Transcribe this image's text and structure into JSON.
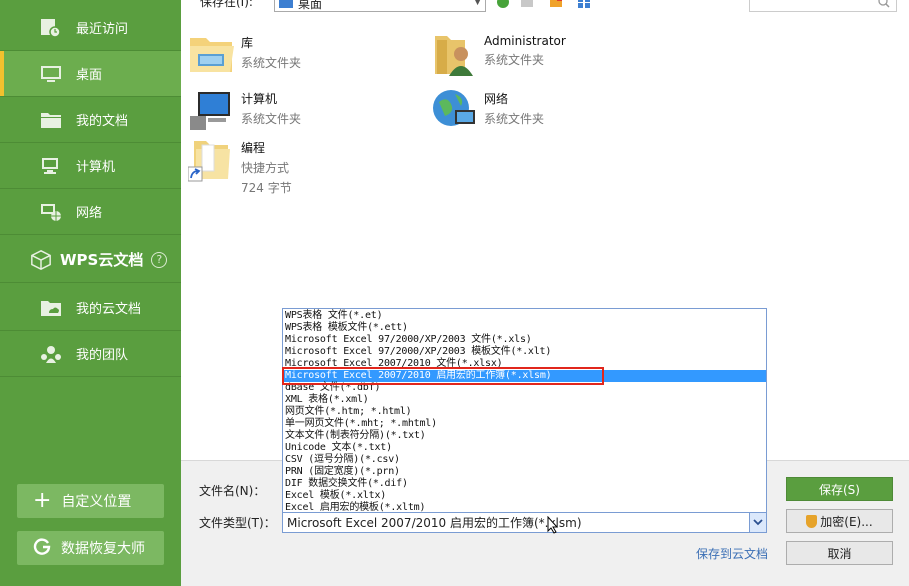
{
  "sidebar": {
    "items": [
      {
        "label": "最近访问",
        "icon": "recent-clock-icon"
      },
      {
        "label": "桌面",
        "icon": "desktop-icon",
        "active": true
      },
      {
        "label": "我的文档",
        "icon": "documents-folder-icon"
      },
      {
        "label": "计算机",
        "icon": "computer-icon"
      },
      {
        "label": "网络",
        "icon": "network-icon"
      }
    ],
    "cloud": {
      "title": "WPS云文档",
      "help": "?",
      "items": [
        {
          "label": "我的云文档",
          "icon": "cloud-docs-icon"
        },
        {
          "label": "我的团队",
          "icon": "team-icon"
        }
      ]
    },
    "custom_location": "自定义位置",
    "data_recovery": "数据恢复大师"
  },
  "toolbar": {
    "save_in_label": "保存在(I):",
    "save_in_value": "桌面"
  },
  "files": [
    {
      "name": "库",
      "sub1": "系统文件夹",
      "sub2": "",
      "icon": "library-folder-icon"
    },
    {
      "name": "Administrator",
      "sub1": "系统文件夹",
      "sub2": "",
      "icon": "user-folder-icon"
    },
    {
      "name": "计算机",
      "sub1": "系统文件夹",
      "sub2": "",
      "icon": "computer-icon"
    },
    {
      "name": "网络",
      "sub1": "系统文件夹",
      "sub2": "",
      "icon": "network-globe-icon"
    },
    {
      "name": "编程",
      "sub1": "快捷方式",
      "sub2": "724 字节",
      "icon": "shortcut-folder-icon"
    }
  ],
  "form": {
    "filename_label": "文件名(N)：",
    "filetype_label": "文件类型(T)：",
    "filetype_value": "Microsoft Excel 2007/2010 启用宏的工作簿(*.xlsm)",
    "save_to_cloud": "保存到云文档",
    "save_button": "保存(S)",
    "encrypt_button": "加密(E)...",
    "cancel_button": "取消"
  },
  "filetype_options": [
    "WPS表格 文件(*.et)",
    "WPS表格 模板文件(*.ett)",
    "Microsoft Excel 97/2000/XP/2003 文件(*.xls)",
    "Microsoft Excel 97/2000/XP/2003 模板文件(*.xlt)",
    "Microsoft Excel 2007/2010 文件(*.xlsx)",
    "Microsoft Excel 2007/2010 启用宏的工作簿(*.xlsm)",
    "dBase 文件(*.dbf)",
    "XML 表格(*.xml)",
    "网页文件(*.htm; *.html)",
    "单一网页文件(*.mht; *.mhtml)",
    "文本文件(制表符分隔)(*.txt)",
    "Unicode 文本(*.txt)",
    "CSV (逗号分隔)(*.csv)",
    "PRN (固定宽度)(*.prn)",
    "DIF 数据交换文件(*.dif)",
    "Excel 模板(*.xltx)",
    "Excel 启用宏的模板(*.xltm)"
  ],
  "selected_option_index": 5,
  "colors": {
    "sidebar_green": "#5a9e3f",
    "primary_button": "#5a9e3f",
    "selection_blue": "#3399ff",
    "highlight_red": "#e1261c",
    "link_blue": "#3b6fb5"
  }
}
